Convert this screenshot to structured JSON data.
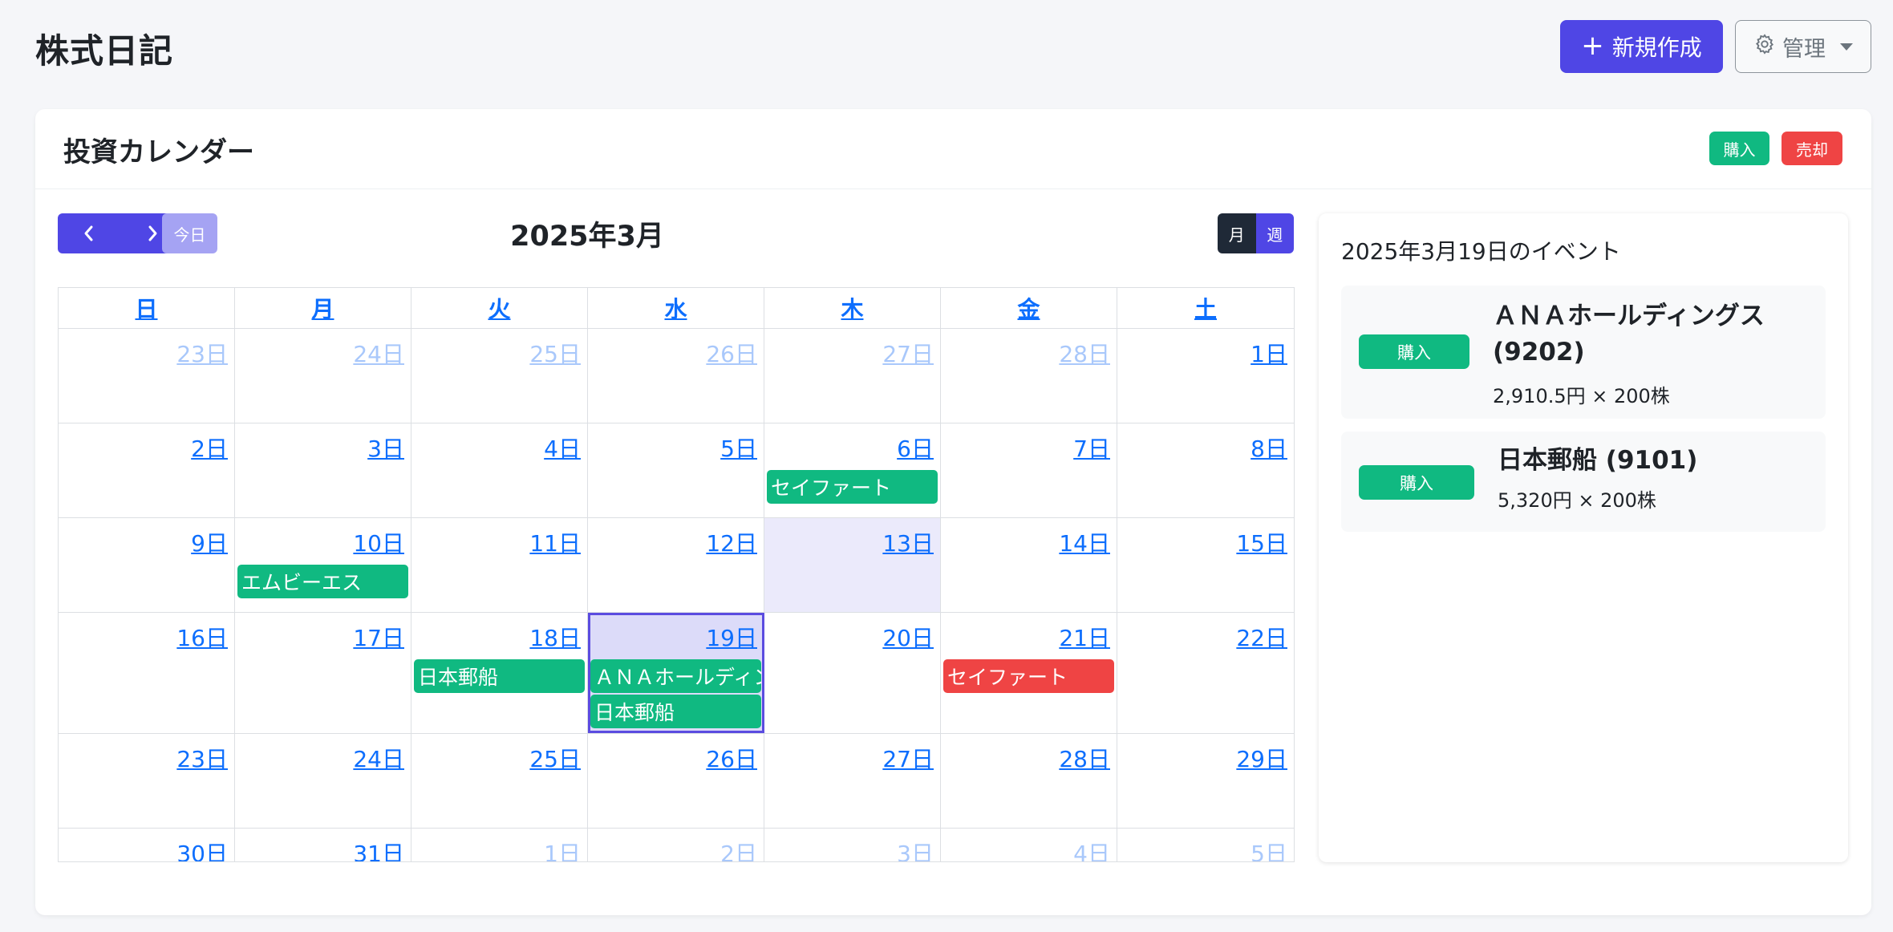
{
  "app": {
    "title": "株式日記",
    "new_button": "新規作成",
    "new_icon": "plus-icon",
    "admin_button": "管理",
    "admin_icon": "gear-icon"
  },
  "card": {
    "title": "投資カレンダー",
    "legend": {
      "buy": "購入",
      "sell": "売却",
      "buy_color": "#10b981",
      "sell_color": "#ef4444"
    }
  },
  "toolbar": {
    "prev_icon": "chevron-left-icon",
    "next_icon": "chevron-right-icon",
    "today": "今日",
    "month_title": "2025年3月",
    "view_month": "月",
    "view_week": "週"
  },
  "calendar": {
    "weekdays": [
      "日",
      "月",
      "火",
      "水",
      "木",
      "金",
      "土"
    ],
    "weeks": [
      [
        {
          "label": "23日",
          "other": true
        },
        {
          "label": "24日",
          "other": true
        },
        {
          "label": "25日",
          "other": true
        },
        {
          "label": "26日",
          "other": true
        },
        {
          "label": "27日",
          "other": true
        },
        {
          "label": "28日",
          "other": true
        },
        {
          "label": "1日"
        }
      ],
      [
        {
          "label": "2日"
        },
        {
          "label": "3日"
        },
        {
          "label": "4日"
        },
        {
          "label": "5日"
        },
        {
          "label": "6日",
          "events": [
            {
              "name": "セイファート",
              "type": "buy"
            }
          ]
        },
        {
          "label": "7日"
        },
        {
          "label": "8日"
        }
      ],
      [
        {
          "label": "9日"
        },
        {
          "label": "10日",
          "events": [
            {
              "name": "エムビーエス",
              "type": "buy"
            }
          ]
        },
        {
          "label": "11日"
        },
        {
          "label": "12日"
        },
        {
          "label": "13日",
          "today": true
        },
        {
          "label": "14日"
        },
        {
          "label": "15日"
        }
      ],
      [
        {
          "label": "16日"
        },
        {
          "label": "17日"
        },
        {
          "label": "18日",
          "events": [
            {
              "name": "日本郵船",
              "type": "buy"
            }
          ]
        },
        {
          "label": "19日",
          "selected": true,
          "events": [
            {
              "name": "ＡＮＡホールディングス",
              "type": "buy"
            },
            {
              "name": "日本郵船",
              "type": "buy"
            }
          ]
        },
        {
          "label": "20日"
        },
        {
          "label": "21日",
          "events": [
            {
              "name": "セイファート",
              "type": "sell"
            }
          ]
        },
        {
          "label": "22日"
        }
      ],
      [
        {
          "label": "23日"
        },
        {
          "label": "24日"
        },
        {
          "label": "25日"
        },
        {
          "label": "26日"
        },
        {
          "label": "27日"
        },
        {
          "label": "28日"
        },
        {
          "label": "29日"
        }
      ],
      [
        {
          "label": "30日"
        },
        {
          "label": "31日"
        },
        {
          "label": "1日",
          "other": true
        },
        {
          "label": "2日",
          "other": true
        },
        {
          "label": "3日",
          "other": true
        },
        {
          "label": "4日",
          "other": true
        },
        {
          "label": "5日",
          "other": true
        }
      ]
    ]
  },
  "side": {
    "title": "2025年3月19日のイベント",
    "events": [
      {
        "badge": "購入",
        "name": "ＡＮＡホールディングス (9202)",
        "detail": "2,910.5円 × 200株"
      },
      {
        "badge": "購入",
        "name": "日本郵船 (9101)",
        "detail": "5,320円 × 200株"
      }
    ]
  }
}
